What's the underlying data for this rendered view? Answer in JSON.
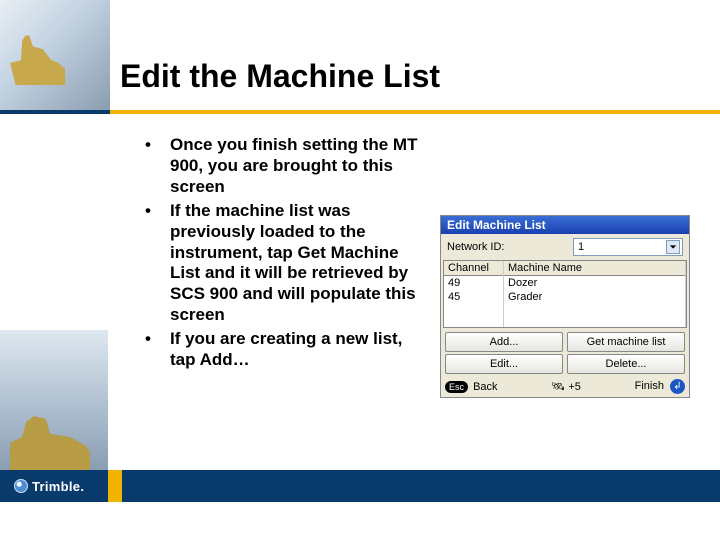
{
  "slide": {
    "title": "Edit the Machine List",
    "bullets": [
      "Once you finish setting the MT 900, you are brought to this screen",
      "If the machine list was previously loaded to the instrument, tap Get Machine List and it will be retrieved by SCS 900 and will populate this screen",
      "If you are creating a new list, tap Add…"
    ]
  },
  "screenshot": {
    "window_title": "Edit Machine List",
    "network_label": "Network ID:",
    "network_value": "1",
    "columns": {
      "channel": "Channel",
      "name": "Machine Name"
    },
    "rows": [
      {
        "channel": "49",
        "name": "Dozer"
      },
      {
        "channel": "45",
        "name": "Grader"
      }
    ],
    "buttons": {
      "add": "Add...",
      "get": "Get machine list",
      "edit": "Edit...",
      "delete": "Delete..."
    },
    "status": {
      "back_key": "Esc",
      "back": "Back",
      "sat": "+5",
      "finish": "Finish"
    }
  },
  "footer": {
    "brand": "Trimble."
  }
}
